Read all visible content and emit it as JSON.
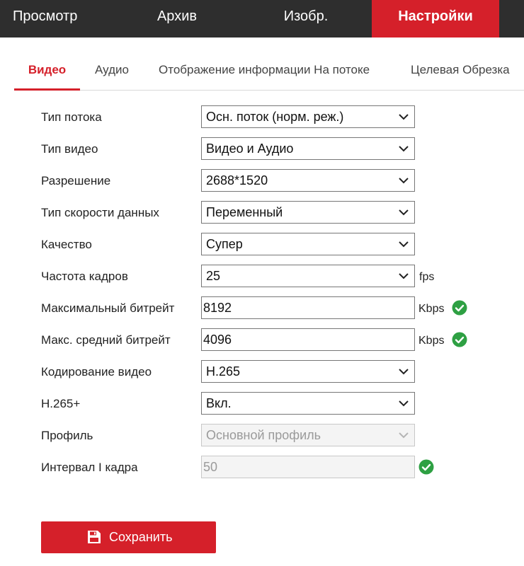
{
  "top_nav": {
    "items": [
      {
        "label": "Просмотр"
      },
      {
        "label": "Архив"
      },
      {
        "label": "Изобр."
      },
      {
        "label": "Настройки"
      }
    ],
    "active_index": 3
  },
  "sub_tabs": {
    "items": [
      {
        "label": "Видео"
      },
      {
        "label": "Аудио"
      },
      {
        "label": "Отображение информации На потоке"
      },
      {
        "label": "Целевая Обрезка"
      }
    ],
    "active_index": 0
  },
  "form": {
    "stream_type": {
      "label": "Тип потока",
      "value": "Осн. поток (норм. реж.)"
    },
    "video_type": {
      "label": "Тип видео",
      "value": "Видео и Аудио"
    },
    "resolution": {
      "label": "Разрешение",
      "value": "2688*1520"
    },
    "bitrate_type": {
      "label": "Тип скорости данных",
      "value": "Переменный"
    },
    "quality": {
      "label": "Качество",
      "value": "Супер"
    },
    "frame_rate": {
      "label": "Частота кадров",
      "value": "25",
      "unit": "fps"
    },
    "max_bitrate": {
      "label": "Максимальный битрейт",
      "value": "8192",
      "unit": "Kbps"
    },
    "avg_bitrate": {
      "label": "Макс. средний битрейт",
      "value": "4096",
      "unit": "Kbps"
    },
    "video_encoding": {
      "label": "Кодирование видео",
      "value": "H.265"
    },
    "h265_plus": {
      "label": "H.265+",
      "value": "Вкл."
    },
    "profile": {
      "label": "Профиль",
      "value": "Основной профиль"
    },
    "i_frame_interval": {
      "label": "Интервал I кадра",
      "value": "50"
    }
  },
  "save_button": {
    "label": "Сохранить",
    "icon": "save-icon"
  },
  "colors": {
    "accent": "#d5202a",
    "topbar": "#2e2e2e",
    "ok": "#2ea043"
  }
}
